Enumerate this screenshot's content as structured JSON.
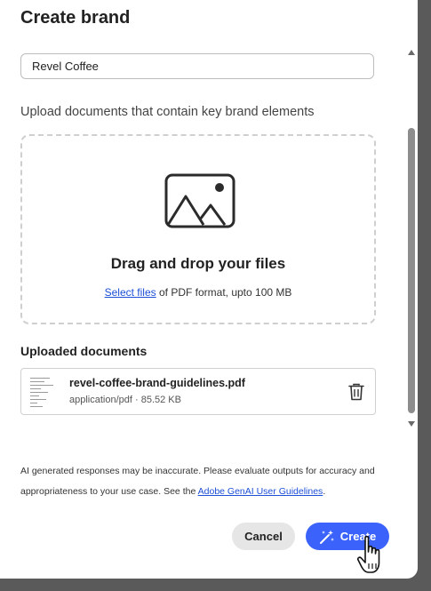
{
  "dialog": {
    "title": "Create brand",
    "brand_name_value": "Revel Coffee",
    "upload_label": "Upload documents that contain key brand elements"
  },
  "dropzone": {
    "title": "Drag and drop your files",
    "select_link": "Select files",
    "hint": " of PDF format, upto 100 MB"
  },
  "uploaded": {
    "title": "Uploaded documents",
    "files": [
      {
        "name": "revel-coffee-brand-guidelines.pdf",
        "meta": "application/pdf · 85.52 KB"
      }
    ]
  },
  "disclaimer": {
    "text": "AI generated responses may be inaccurate. Please evaluate outputs for accuracy and appropriateness to your use case. See the ",
    "link": "Adobe GenAI User Guidelines",
    "end": "."
  },
  "actions": {
    "cancel_label": "Cancel",
    "create_label": "Create"
  },
  "colors": {
    "accent": "#3b63fb",
    "link": "#1d4fd8"
  },
  "icons": {
    "dropzone": "image-icon",
    "delete": "trash-icon",
    "create": "magic-wand-icon",
    "pointer": "hand-cursor-icon"
  }
}
